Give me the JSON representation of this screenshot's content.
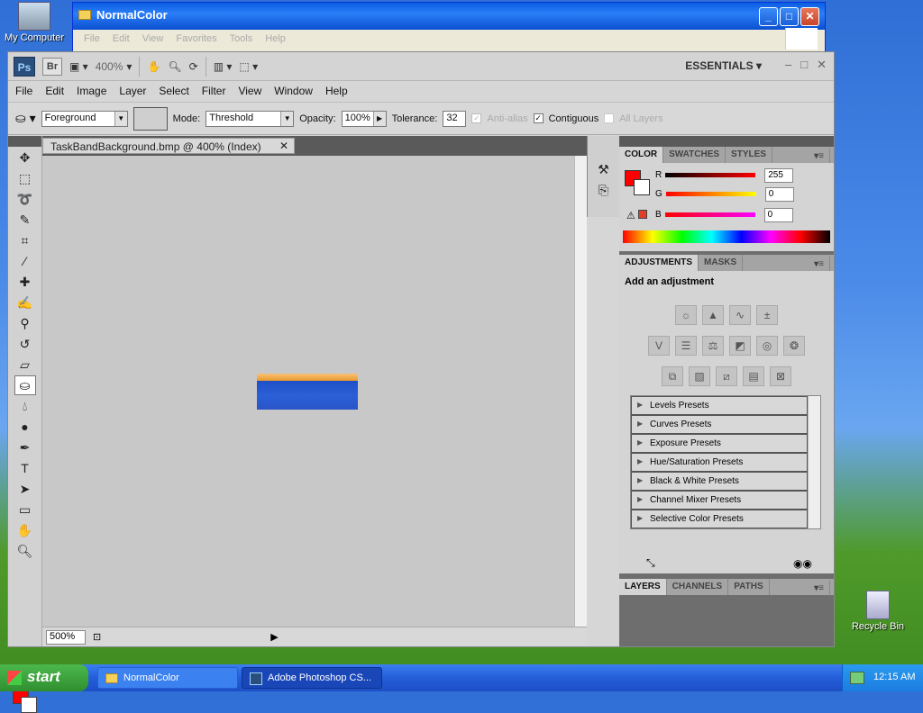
{
  "desktop": {
    "my_computer": "My Computer",
    "recycle_bin": "Recycle Bin"
  },
  "explorer": {
    "title": "NormalColor",
    "menu": [
      "File",
      "Edit",
      "View",
      "Favorites",
      "Tools",
      "Help"
    ]
  },
  "photoshop": {
    "logo": "Ps",
    "bridge": "Br",
    "zoom_level": "400%",
    "workspace": "ESSENTIALS",
    "menu": [
      "File",
      "Edit",
      "Image",
      "Layer",
      "Select",
      "Filter",
      "View",
      "Window",
      "Help"
    ],
    "options": {
      "fill_source": "Foreground",
      "mode_label": "Mode:",
      "mode_value": "Threshold",
      "opacity_label": "Opacity:",
      "opacity_value": "100%",
      "tolerance_label": "Tolerance:",
      "tolerance_value": "32",
      "antialias_label": "Anti-alias",
      "contiguous_label": "Contiguous",
      "all_layers_label": "All Layers"
    },
    "document": {
      "tab_title": "TaskBandBackground.bmp @ 400% (Index)",
      "status_zoom": "500%"
    },
    "color_panel": {
      "tabs": [
        "COLOR",
        "SWATCHES",
        "STYLES"
      ],
      "r_label": "R",
      "r_value": "255",
      "g_label": "G",
      "g_value": "0",
      "b_label": "B",
      "b_value": "0",
      "foreground_color": "#ff0000"
    },
    "adjustments_panel": {
      "tabs": [
        "ADJUSTMENTS",
        "MASKS"
      ],
      "title": "Add an adjustment",
      "presets": [
        "Levels Presets",
        "Curves Presets",
        "Exposure Presets",
        "Hue/Saturation Presets",
        "Black & White Presets",
        "Channel Mixer Presets",
        "Selective Color Presets"
      ]
    },
    "layers_panel": {
      "tabs": [
        "LAYERS",
        "CHANNELS",
        "PATHS"
      ]
    }
  },
  "taskbar": {
    "start": "start",
    "task1": "NormalColor",
    "task2": "Adobe Photoshop CS...",
    "clock": "12:15 AM"
  }
}
